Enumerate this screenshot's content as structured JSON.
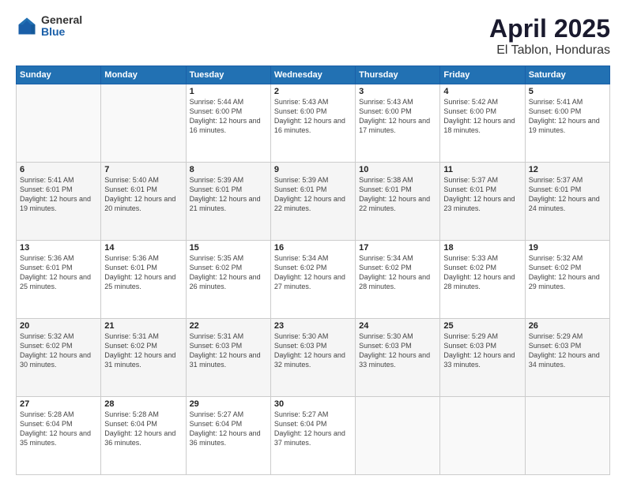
{
  "header": {
    "logo_general": "General",
    "logo_blue": "Blue",
    "month": "April 2025",
    "location": "El Tablon, Honduras"
  },
  "weekdays": [
    "Sunday",
    "Monday",
    "Tuesday",
    "Wednesday",
    "Thursday",
    "Friday",
    "Saturday"
  ],
  "weeks": [
    [
      {
        "day": "",
        "info": ""
      },
      {
        "day": "",
        "info": ""
      },
      {
        "day": "1",
        "info": "Sunrise: 5:44 AM\nSunset: 6:00 PM\nDaylight: 12 hours and 16 minutes."
      },
      {
        "day": "2",
        "info": "Sunrise: 5:43 AM\nSunset: 6:00 PM\nDaylight: 12 hours and 16 minutes."
      },
      {
        "day": "3",
        "info": "Sunrise: 5:43 AM\nSunset: 6:00 PM\nDaylight: 12 hours and 17 minutes."
      },
      {
        "day": "4",
        "info": "Sunrise: 5:42 AM\nSunset: 6:00 PM\nDaylight: 12 hours and 18 minutes."
      },
      {
        "day": "5",
        "info": "Sunrise: 5:41 AM\nSunset: 6:00 PM\nDaylight: 12 hours and 19 minutes."
      }
    ],
    [
      {
        "day": "6",
        "info": "Sunrise: 5:41 AM\nSunset: 6:01 PM\nDaylight: 12 hours and 19 minutes."
      },
      {
        "day": "7",
        "info": "Sunrise: 5:40 AM\nSunset: 6:01 PM\nDaylight: 12 hours and 20 minutes."
      },
      {
        "day": "8",
        "info": "Sunrise: 5:39 AM\nSunset: 6:01 PM\nDaylight: 12 hours and 21 minutes."
      },
      {
        "day": "9",
        "info": "Sunrise: 5:39 AM\nSunset: 6:01 PM\nDaylight: 12 hours and 22 minutes."
      },
      {
        "day": "10",
        "info": "Sunrise: 5:38 AM\nSunset: 6:01 PM\nDaylight: 12 hours and 22 minutes."
      },
      {
        "day": "11",
        "info": "Sunrise: 5:37 AM\nSunset: 6:01 PM\nDaylight: 12 hours and 23 minutes."
      },
      {
        "day": "12",
        "info": "Sunrise: 5:37 AM\nSunset: 6:01 PM\nDaylight: 12 hours and 24 minutes."
      }
    ],
    [
      {
        "day": "13",
        "info": "Sunrise: 5:36 AM\nSunset: 6:01 PM\nDaylight: 12 hours and 25 minutes."
      },
      {
        "day": "14",
        "info": "Sunrise: 5:36 AM\nSunset: 6:01 PM\nDaylight: 12 hours and 25 minutes."
      },
      {
        "day": "15",
        "info": "Sunrise: 5:35 AM\nSunset: 6:02 PM\nDaylight: 12 hours and 26 minutes."
      },
      {
        "day": "16",
        "info": "Sunrise: 5:34 AM\nSunset: 6:02 PM\nDaylight: 12 hours and 27 minutes."
      },
      {
        "day": "17",
        "info": "Sunrise: 5:34 AM\nSunset: 6:02 PM\nDaylight: 12 hours and 28 minutes."
      },
      {
        "day": "18",
        "info": "Sunrise: 5:33 AM\nSunset: 6:02 PM\nDaylight: 12 hours and 28 minutes."
      },
      {
        "day": "19",
        "info": "Sunrise: 5:32 AM\nSunset: 6:02 PM\nDaylight: 12 hours and 29 minutes."
      }
    ],
    [
      {
        "day": "20",
        "info": "Sunrise: 5:32 AM\nSunset: 6:02 PM\nDaylight: 12 hours and 30 minutes."
      },
      {
        "day": "21",
        "info": "Sunrise: 5:31 AM\nSunset: 6:02 PM\nDaylight: 12 hours and 31 minutes."
      },
      {
        "day": "22",
        "info": "Sunrise: 5:31 AM\nSunset: 6:03 PM\nDaylight: 12 hours and 31 minutes."
      },
      {
        "day": "23",
        "info": "Sunrise: 5:30 AM\nSunset: 6:03 PM\nDaylight: 12 hours and 32 minutes."
      },
      {
        "day": "24",
        "info": "Sunrise: 5:30 AM\nSunset: 6:03 PM\nDaylight: 12 hours and 33 minutes."
      },
      {
        "day": "25",
        "info": "Sunrise: 5:29 AM\nSunset: 6:03 PM\nDaylight: 12 hours and 33 minutes."
      },
      {
        "day": "26",
        "info": "Sunrise: 5:29 AM\nSunset: 6:03 PM\nDaylight: 12 hours and 34 minutes."
      }
    ],
    [
      {
        "day": "27",
        "info": "Sunrise: 5:28 AM\nSunset: 6:04 PM\nDaylight: 12 hours and 35 minutes."
      },
      {
        "day": "28",
        "info": "Sunrise: 5:28 AM\nSunset: 6:04 PM\nDaylight: 12 hours and 36 minutes."
      },
      {
        "day": "29",
        "info": "Sunrise: 5:27 AM\nSunset: 6:04 PM\nDaylight: 12 hours and 36 minutes."
      },
      {
        "day": "30",
        "info": "Sunrise: 5:27 AM\nSunset: 6:04 PM\nDaylight: 12 hours and 37 minutes."
      },
      {
        "day": "",
        "info": ""
      },
      {
        "day": "",
        "info": ""
      },
      {
        "day": "",
        "info": ""
      }
    ]
  ]
}
